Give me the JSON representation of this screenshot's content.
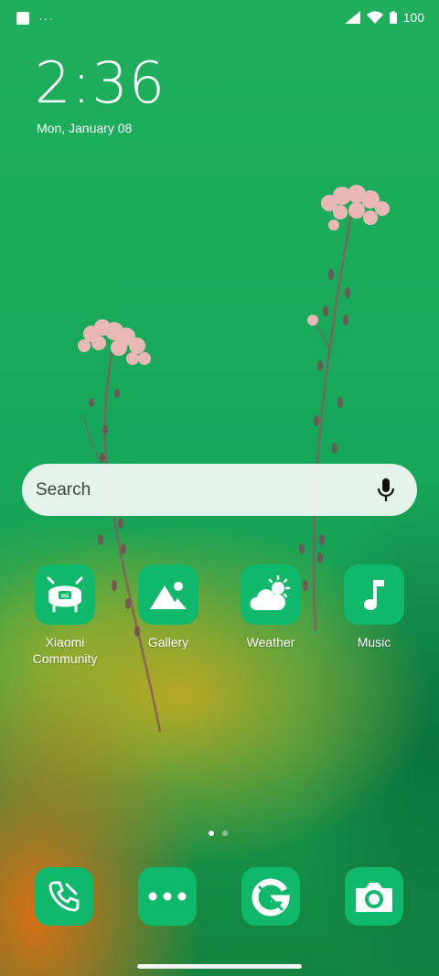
{
  "status_bar": {
    "battery_level": "100",
    "icons": [
      "notification-square-icon",
      "more-dots-icon",
      "signal-icon",
      "wifi-icon",
      "battery-icon"
    ],
    "more_indicator": "···"
  },
  "clock": {
    "time": "2:36",
    "date": "Mon, January 08"
  },
  "search": {
    "placeholder": "Search"
  },
  "apps": [
    {
      "label": "Xiaomi Community",
      "icon": "xiaomi-community-icon"
    },
    {
      "label": "Gallery",
      "icon": "gallery-icon"
    },
    {
      "label": "Weather",
      "icon": "weather-icon"
    },
    {
      "label": "Music",
      "icon": "music-icon"
    }
  ],
  "pager": {
    "pages": 2,
    "active": 1
  },
  "dock": [
    {
      "icon": "phone-icon"
    },
    {
      "icon": "messages-icon"
    },
    {
      "icon": "google-icon"
    },
    {
      "icon": "camera-icon"
    }
  ],
  "colors": {
    "icon_background": "#0fb86a",
    "wallpaper_green": "#1faf5c",
    "wallpaper_orange": "#e26e14"
  }
}
